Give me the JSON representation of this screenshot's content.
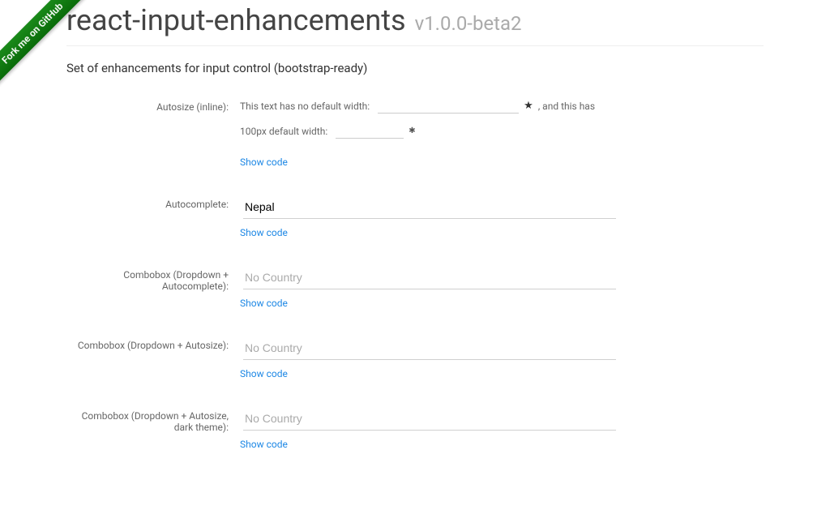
{
  "ribbon": "Fork me on GitHub",
  "header": {
    "title": "react-input-enhancements",
    "version": "v1.0.0-beta2",
    "subtitle": "Set of enhancements for input control (bootstrap-ready)"
  },
  "sections": {
    "autosize": {
      "label": "Autosize (inline):",
      "line1_a": "This text has no default width:",
      "line1_b": ", and this has",
      "line2_a": "100px default width:",
      "show_code": "Show code"
    },
    "autocomplete": {
      "label": "Autocomplete:",
      "value": "Nepal",
      "show_code": "Show code"
    },
    "combobox1": {
      "label": "Combobox (Dropdown + Autocomplete):",
      "placeholder": "No Country",
      "show_code": "Show code"
    },
    "combobox2": {
      "label": "Combobox (Dropdown + Autosize):",
      "placeholder": "No Country",
      "show_code": "Show code"
    },
    "combobox3": {
      "label": "Combobox (Dropdown + Autosize, dark theme):",
      "placeholder": "No Country",
      "show_code": "Show code"
    }
  }
}
